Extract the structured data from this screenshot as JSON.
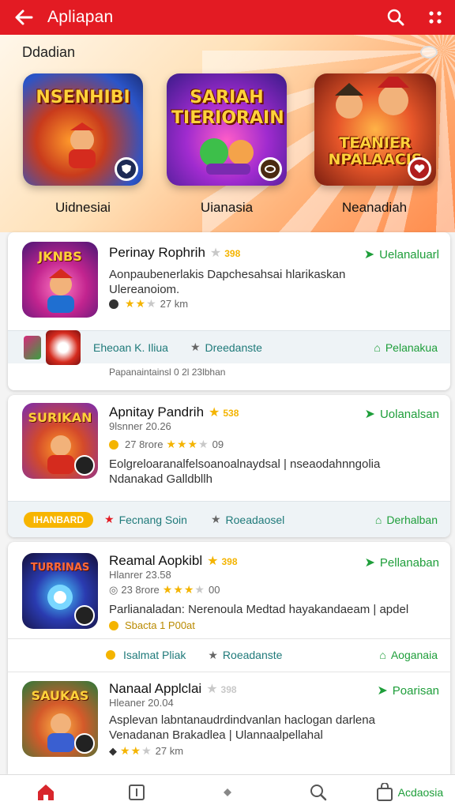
{
  "appbar": {
    "title": "Apliapan",
    "back_icon": "back-arrow-icon",
    "search_icon": "search-icon",
    "menu_icon": "grid-menu-icon",
    "color": "#e31b23"
  },
  "hero": {
    "label": "Ddadian",
    "featured": [
      {
        "art": "NSENHIBI",
        "name": "Uidnesiai",
        "badge_icon": "shield-icon"
      },
      {
        "art": "SARIAH TIERIORAIN",
        "name": "Uianasia",
        "badge_icon": "ring-icon"
      },
      {
        "art": "TEANIER NPALAACIS",
        "name": "Neanadiah",
        "badge_icon": "heart-icon"
      }
    ]
  },
  "cards": [
    {
      "art": "JKNBS",
      "title": "Perinay Rophrih",
      "rating": "398",
      "action": "Uelanaluarl",
      "description": "Aonpaubenerlakis Dapchesahsai hlarikaskan Ulereanoiom.",
      "meta": "27 km",
      "strip": {
        "left": "Eheoan K. Iliua",
        "mid": "Dreedanste",
        "right": "Pelanakua",
        "note": "Papanaintainsl 0 2l 23lbhan"
      }
    },
    {
      "art": "SURIKAN",
      "title": "Apnitay Pandrih",
      "rating": "538",
      "action": "Uolanalsan",
      "subtitle": "9lsnner 20.26",
      "meta_left": "27 8rore",
      "meta": "09",
      "description": "Eolgreloaranalfelsoanoalnaydsal | nseaodahnngolia Ndanakad Galldbllh",
      "strip": {
        "pill": "IHANBARD",
        "mid1": "Fecnang Soin",
        "mid2": "Roeadaosel",
        "right": "Derhalban"
      }
    },
    {
      "art": "TURRINAS",
      "title": "Reamal Aopkibl",
      "rating": "398",
      "action": "Pellanaban",
      "subtitle": "Hlanrer 23.58",
      "meta_left": "23 8rore",
      "meta": "00",
      "description": "Parlianaladan: Nerenoula Medtad hayakandaeam | apdel",
      "extra": "Sbacta 1 P00at",
      "strip": {
        "left": "Isalmat Pliak",
        "mid": "Roeadanste",
        "right": "Aoganaia"
      }
    },
    {
      "art": "SAUKAS",
      "title": "Nanaal Applclai",
      "rating": "398",
      "action": "Poarisan",
      "subtitle": "Hleaner 20.04",
      "description": "Asplevan labntanaudrdindvanlan haclogan darlena Venadanan Brakadlea | Ulannaalpellahal",
      "meta": "27 km"
    }
  ],
  "bottom_nav": {
    "home_icon": "home-icon",
    "book_icon": "book-icon",
    "diamond_icon": "diamond-icon",
    "search_icon": "search-icon",
    "bag_icon": "shopping-bag-icon",
    "bag_label": "Acdaosia"
  }
}
